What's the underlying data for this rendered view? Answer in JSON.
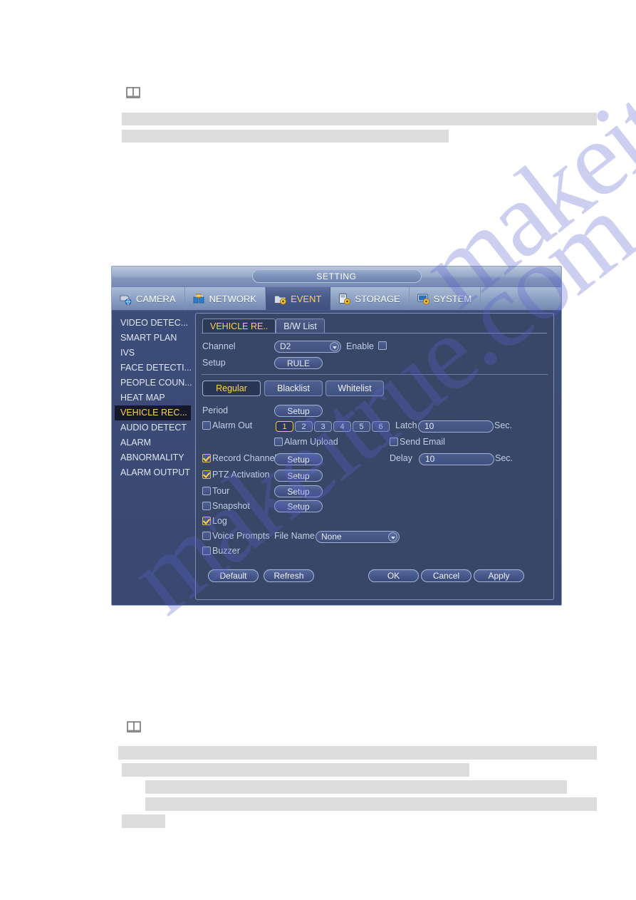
{
  "page": {
    "watermark_text": "makeitrue.com"
  },
  "notes": [
    {
      "icon": "book-note-icon"
    },
    {
      "icon": "book-note-icon"
    }
  ],
  "window": {
    "title": "SETTING",
    "tabs": [
      {
        "label": "CAMERA",
        "icon": "camera-icon",
        "active": false
      },
      {
        "label": "NETWORK",
        "icon": "network-icon",
        "active": false
      },
      {
        "label": "EVENT",
        "icon": "event-icon",
        "active": true
      },
      {
        "label": "STORAGE",
        "icon": "storage-icon",
        "active": false
      },
      {
        "label": "SYSTEM",
        "icon": "system-icon",
        "active": false
      }
    ],
    "sidebar": {
      "items": [
        {
          "label": "VIDEO DETEC...",
          "active": false
        },
        {
          "label": "SMART PLAN",
          "active": false
        },
        {
          "label": "IVS",
          "active": false
        },
        {
          "label": "FACE DETECTI...",
          "active": false
        },
        {
          "label": "PEOPLE COUN...",
          "active": false
        },
        {
          "label": "HEAT MAP",
          "active": false
        },
        {
          "label": "VEHICLE REC...",
          "active": true
        },
        {
          "label": "AUDIO DETECT",
          "active": false
        },
        {
          "label": "ALARM",
          "active": false
        },
        {
          "label": "ABNORMALITY",
          "active": false
        },
        {
          "label": "ALARM OUTPUT",
          "active": false
        }
      ]
    },
    "panel": {
      "subtabs": [
        {
          "label": "VEHICLE RE..",
          "active": true
        },
        {
          "label": "B/W List",
          "active": false
        }
      ],
      "channel_label": "Channel",
      "channel_value": "D2",
      "enable_label": "Enable",
      "enable_checked": false,
      "setup_label": "Setup",
      "rule_button": "RULE",
      "modes": [
        {
          "label": "Regular",
          "active": true
        },
        {
          "label": "Blacklist",
          "active": false
        },
        {
          "label": "Whitelist",
          "active": false
        }
      ],
      "period_label": "Period",
      "period_button": "Setup",
      "alarm_out_label": "Alarm Out",
      "alarm_out_checked": false,
      "alarm_out_numbers": [
        "1",
        "2",
        "3",
        "4",
        "5",
        "6"
      ],
      "alarm_out_selected": "1",
      "latch_label": "Latch",
      "latch_value": "10",
      "latch_unit": "Sec.",
      "alarm_upload_label": "Alarm Upload",
      "alarm_upload_checked": false,
      "send_email_label": "Send Email",
      "send_email_checked": false,
      "record_channel_label": "Record Channel",
      "record_channel_checked": true,
      "record_channel_button": "Setup",
      "delay_label": "Delay",
      "delay_value": "10",
      "delay_unit": "Sec.",
      "ptz_activation_label": "PTZ Activation",
      "ptz_activation_checked": true,
      "ptz_activation_button": "Setup",
      "tour_label": "Tour",
      "tour_checked": false,
      "tour_button": "Setup",
      "snapshot_label": "Snapshot",
      "snapshot_checked": false,
      "snapshot_button": "Setup",
      "log_label": "Log",
      "log_checked": true,
      "voice_prompts_label": "Voice Prompts",
      "voice_prompts_checked": false,
      "file_name_label": "File Name",
      "file_name_value": "None",
      "buzzer_label": "Buzzer",
      "buzzer_checked": false,
      "footer": {
        "default_label": "Default",
        "refresh_label": "Refresh",
        "ok_label": "OK",
        "cancel_label": "Cancel",
        "apply_label": "Apply"
      }
    }
  },
  "colors": {
    "accent_yellow": "#ffd24d",
    "window_blue": "#39486f",
    "panel_blue": "#384767",
    "redaction_grey": "#dcdcdc"
  }
}
